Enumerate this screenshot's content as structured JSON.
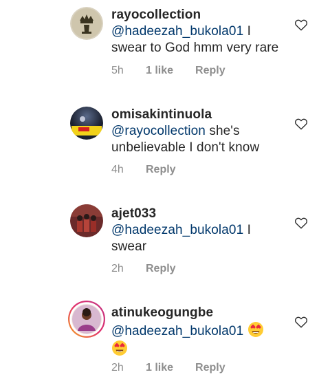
{
  "comments": [
    {
      "username": "rayocollection",
      "mention": "@hadeezah_bukola01",
      "text": " I swear to God hmm very rare",
      "time": "5h",
      "likes": "1 like",
      "reply": "Reply",
      "avatar_icon": "crown-icon"
    },
    {
      "username": "omisakintinuola",
      "mention": "@rayocollection",
      "text": " she's unbelievable I don't know",
      "time": "4h",
      "likes": "",
      "reply": "Reply",
      "avatar_icon": "photo-avatar"
    },
    {
      "username": "ajet033",
      "mention": "@hadeezah_bukola01",
      "text": " I swear",
      "time": "2h",
      "likes": "",
      "reply": "Reply",
      "avatar_icon": "group-photo-avatar"
    },
    {
      "username": "atinukeogungbe",
      "mention": "@hadeezah_bukola01",
      "text": "",
      "time": "2h",
      "likes": "1 like",
      "reply": "Reply",
      "avatar_icon": "portrait-avatar",
      "emoji": "heart-eyes-emoji"
    }
  ],
  "colors": {
    "text": "#262626",
    "mention": "#00376b",
    "meta": "#8e8e8e",
    "story_ring": "#d6249f"
  }
}
